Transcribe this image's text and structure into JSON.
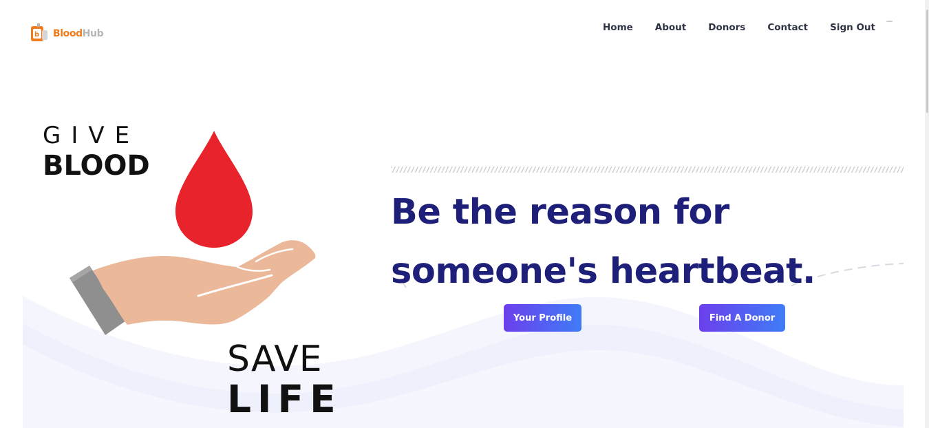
{
  "brand": {
    "name_part1": "Blood",
    "name_part2": "Hub"
  },
  "nav": {
    "items": [
      {
        "label": "Home"
      },
      {
        "label": "About"
      },
      {
        "label": "Donors"
      },
      {
        "label": "Contact"
      },
      {
        "label": "Sign Out"
      }
    ]
  },
  "hero": {
    "graphic": {
      "give": "GIVE",
      "blood": "BLOOD",
      "save": "SAVE",
      "life": "LIFE"
    },
    "headline_line1": "Be the reason for",
    "headline_line2": "someone's heartbeat.",
    "buttons": {
      "profile": "Your Profile",
      "find_donor": "Find A Donor"
    }
  },
  "colors": {
    "brand_orange": "#f07c1b",
    "headline_navy": "#1d1f79",
    "button_gradient_start": "#6c3fec",
    "button_gradient_end": "#3f7cf7",
    "blood_red": "#e8232b",
    "skin": "#ebb89a",
    "wave_lavender": "#eef0fb"
  }
}
